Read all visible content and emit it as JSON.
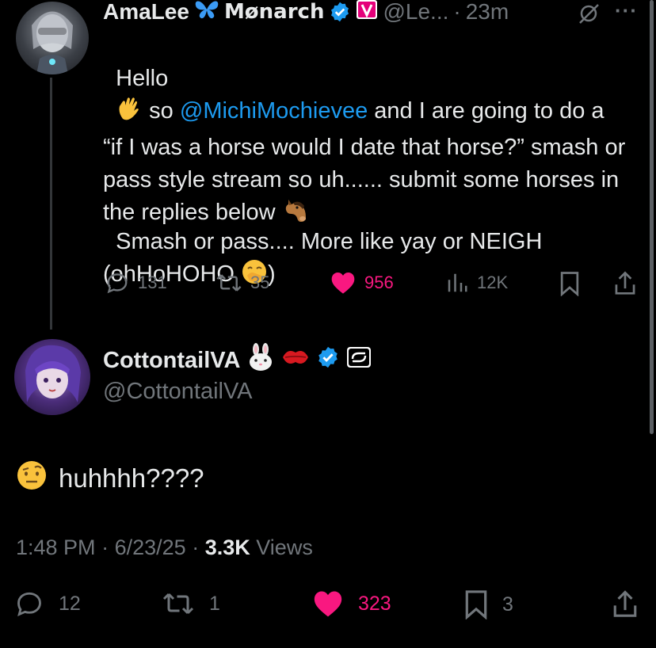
{
  "parent": {
    "display_name": "AmaLee",
    "name_suffix": "Mønarch",
    "handle": "@Le...",
    "separator": "·",
    "time": "23m",
    "more": "···",
    "text_pre": "Hello",
    "text_so": " so ",
    "mention": "@MichiMochievee",
    "text_main": " and I are going to do a “if I was a horse would I date that horse?” smash or pass style stream so uh...... submit some horses in the replies below ",
    "text_p2": "Smash or pass.... More like yay or NEIGH (ohHoHOHO ",
    "text_end": ")",
    "replies": "131",
    "reposts": "35",
    "likes": "956",
    "views": "12K"
  },
  "reply": {
    "display_name": "CottontailVA",
    "handle": "@CottontailVA",
    "text": "huhhhh????",
    "time": "1:48 PM",
    "date": "6/23/25",
    "sep": "·",
    "views_count": "3.3K",
    "views_label": "Views",
    "replies": "12",
    "reposts": "1",
    "likes": "323",
    "bookmarks": "3"
  },
  "colors": {
    "background": "#000000",
    "text": "#e7e9ea",
    "muted": "#71767b",
    "accent": "#1d9bf0",
    "like": "#f91880"
  }
}
